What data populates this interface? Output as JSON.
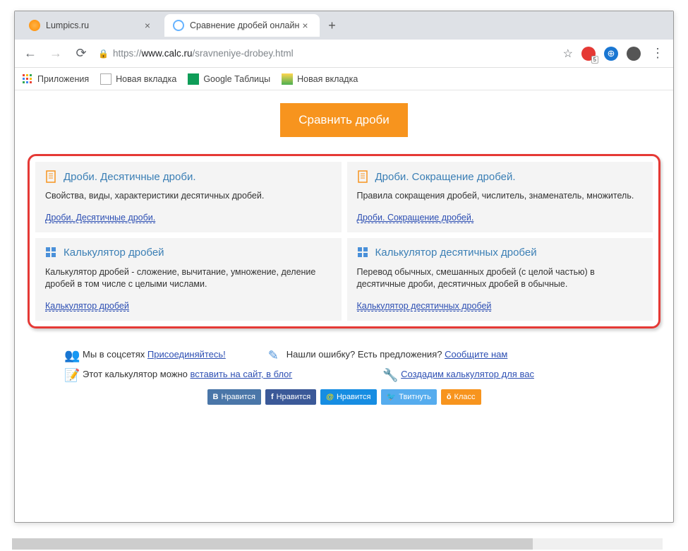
{
  "window": {
    "min": "—",
    "max": "☐",
    "close": "✕"
  },
  "tabs": {
    "t0": {
      "title": "Lumpics.ru"
    },
    "t1": {
      "title": "Сравнение дробей онлайн"
    }
  },
  "address": {
    "proto": "https://",
    "domain": "www.calc.ru",
    "path": "/sravneniye-drobey.html"
  },
  "bookmarks": {
    "apps": "Приложения",
    "nt1": "Новая вкладка",
    "gt": "Google Таблицы",
    "nt2": "Новая вкладка"
  },
  "main_button": "Сравнить дроби",
  "cards": {
    "r0c0": {
      "title": "Дроби. Десятичные дроби.",
      "desc": "Свойства, виды, характеристики десятичных дробей.",
      "link": "Дроби. Десятичные дроби."
    },
    "r0c1": {
      "title": "Дроби. Сокращение дробей.",
      "desc": "Правила сокращения дробей, числитель, знаменатель, множитель.",
      "link": "Дроби. Сокращение дробей."
    },
    "r1c0": {
      "title": "Калькулятор дробей",
      "desc": "Калькулятор дробей - сложение, вычитание, умножение, деление дробей в том числе с целыми числами.",
      "link": "Калькулятор дробей"
    },
    "r1c1": {
      "title": "Калькулятор десятичных дробей",
      "desc": "Перевод обычных, смешанных дробей (с целой частью) в десятичные дроби, десятичных дробей в обычные.",
      "link": "Калькулятор десятичных дробей"
    }
  },
  "footer": {
    "f1a": "Мы в соцсетях ",
    "f1b": "Присоединяйтесь!",
    "f2a": "Нашли ошибку? Есть предложения? ",
    "f2b": "Сообщите нам",
    "f3a": "Этот калькулятор можно ",
    "f3b": "вставить на сайт, в блог",
    "f4": "Создадим калькулятор для вас"
  },
  "social": {
    "vk": "Нравится",
    "fb": "Нравится",
    "mail": "Нравится",
    "tw": "Твитнуть",
    "ok": "Класс"
  }
}
